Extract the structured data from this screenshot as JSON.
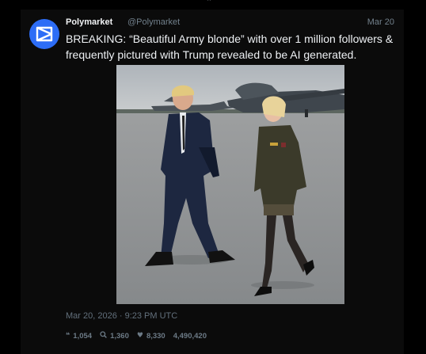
{
  "tweet": {
    "author_name": "Polymarket",
    "author_handle": "@Polymarket",
    "date": "Mar 20",
    "text": "BREAKING: “Beautiful Army blonde” with over 1 million followers & frequently pictured with Trump revealed to be AI generated.",
    "timestamp": "Mar 20, 2026 · 9:23 PM UTC",
    "stats": {
      "replies": "1,054",
      "searches": "1,360",
      "likes": "8,330",
      "views": "4,490,420"
    }
  },
  "icons": {
    "top": "chevron-icon",
    "avatar": "polymarket-logo-icon",
    "replies": "quote-icon",
    "searches": "search-icon",
    "likes": "heart-icon"
  },
  "colors": {
    "background": "#000000",
    "card": "#0b0b0b",
    "avatar": "#2d6df6",
    "text": "#eef1f4",
    "muted": "#72808c"
  }
}
